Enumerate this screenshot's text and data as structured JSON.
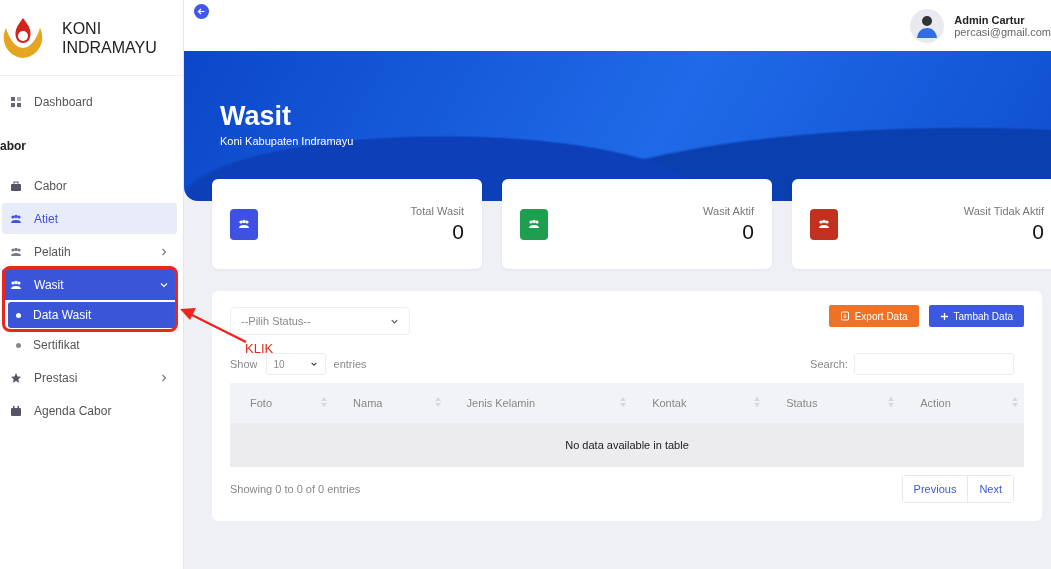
{
  "brand": {
    "line1": "KONI",
    "line2": "INDRAMAYU"
  },
  "sidebar": {
    "items": [
      {
        "kind": "link",
        "label": "Dashboard",
        "selected": false,
        "highlighted": false
      },
      {
        "kind": "heading",
        "label": "abor"
      },
      {
        "kind": "link",
        "label": "Cabor",
        "selected": false,
        "highlighted": false
      },
      {
        "kind": "link",
        "label": "Atiet",
        "selected": false,
        "highlighted": true
      },
      {
        "kind": "group",
        "label": "Pelatih",
        "selected": false,
        "highlighted": false,
        "expanded": false
      },
      {
        "kind": "group",
        "label": "Wasit",
        "selected": true,
        "highlighted": false,
        "expanded": true,
        "children": [
          {
            "label": "Data Wasit",
            "selected": true
          },
          {
            "label": "Sertifikat",
            "selected": false
          }
        ]
      },
      {
        "kind": "group",
        "label": "Prestasi",
        "selected": false,
        "highlighted": false,
        "expanded": false
      },
      {
        "kind": "link",
        "label": "Agenda Cabor",
        "selected": false,
        "highlighted": false
      }
    ]
  },
  "user": {
    "name": "Admin Cartur",
    "email": "percasi@gmail.com"
  },
  "banner": {
    "title": "Wasit",
    "subtitle": "Koni Kabupaten Indramayu"
  },
  "stats": [
    {
      "label": "Total Wasit",
      "value": "0",
      "color": "#3f51e0"
    },
    {
      "label": "Wasit Aktif",
      "value": "0",
      "color": "#1e9e4f"
    },
    {
      "label": "Wasit Tidak Aktif",
      "value": "0",
      "color": "#c0321f"
    }
  ],
  "table": {
    "status_filter": {
      "placeholder": "--Pilih Status--"
    },
    "buttons": [
      {
        "kind": "export",
        "label": "Export Data"
      },
      {
        "kind": "add",
        "label": "Tambah Data"
      }
    ],
    "length": {
      "before": "Show",
      "value": "10",
      "after": "entries"
    },
    "search_label": "Search:",
    "columns": [
      "Foto",
      "Nama",
      "Jenis Kelamin",
      "Kontak",
      "Status",
      "Action"
    ],
    "empty_message": "No data available in table",
    "info": "Showing 0 to 0 of 0 entries",
    "pagination": [
      "Previous",
      "Next"
    ]
  },
  "annotation": {
    "text": "KLIK"
  }
}
